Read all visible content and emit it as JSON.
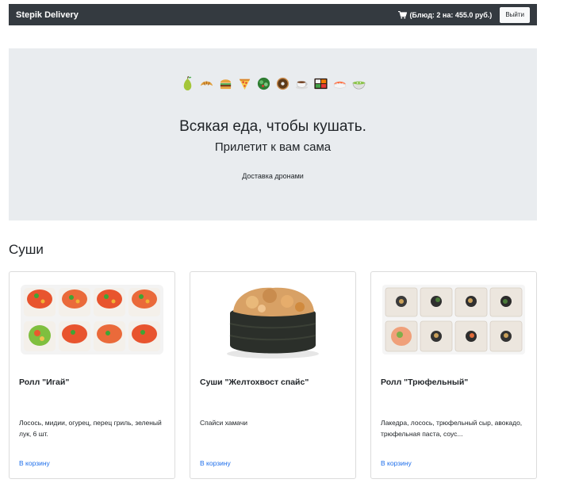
{
  "navbar": {
    "brand": "Stepik Delivery",
    "cart_icon": "shopping-cart-icon",
    "cart_text": "(Блюд: 2 на: 455.0 руб.)",
    "logout_label": "Выйти"
  },
  "hero": {
    "emojis": [
      "pear",
      "croissant",
      "hamburger",
      "pizza",
      "salad",
      "donut",
      "coffee",
      "bento",
      "sushi",
      "soup"
    ],
    "title": "Всякая еда, чтобы кушать.",
    "subtitle": "Прилетит к вам сама",
    "text": "Доставка дронами"
  },
  "section": {
    "title": "Суши"
  },
  "cards": [
    {
      "title": "Ролл \"Игай\"",
      "description": "Лосось, мидии, огурец, перец гриль, зеленый лук, 6 шт.",
      "link": "В корзину",
      "image": "roll-igai-image"
    },
    {
      "title": "Суши \"Желтохвост спайс\"",
      "description": "Спайси хамачи",
      "link": "В корзину",
      "image": "sushi-yellowtail-image"
    },
    {
      "title": "Ролл \"Трюфельный\"",
      "description": "Лакедра, лосось, трюфельный сыр, авокадо, трюфельная паста, соус...",
      "link": "В корзину",
      "image": "roll-truffle-image"
    }
  ],
  "colors": {
    "navbar_bg": "#343a40",
    "hero_bg": "#e9ecef",
    "link": "#1f6feb"
  }
}
